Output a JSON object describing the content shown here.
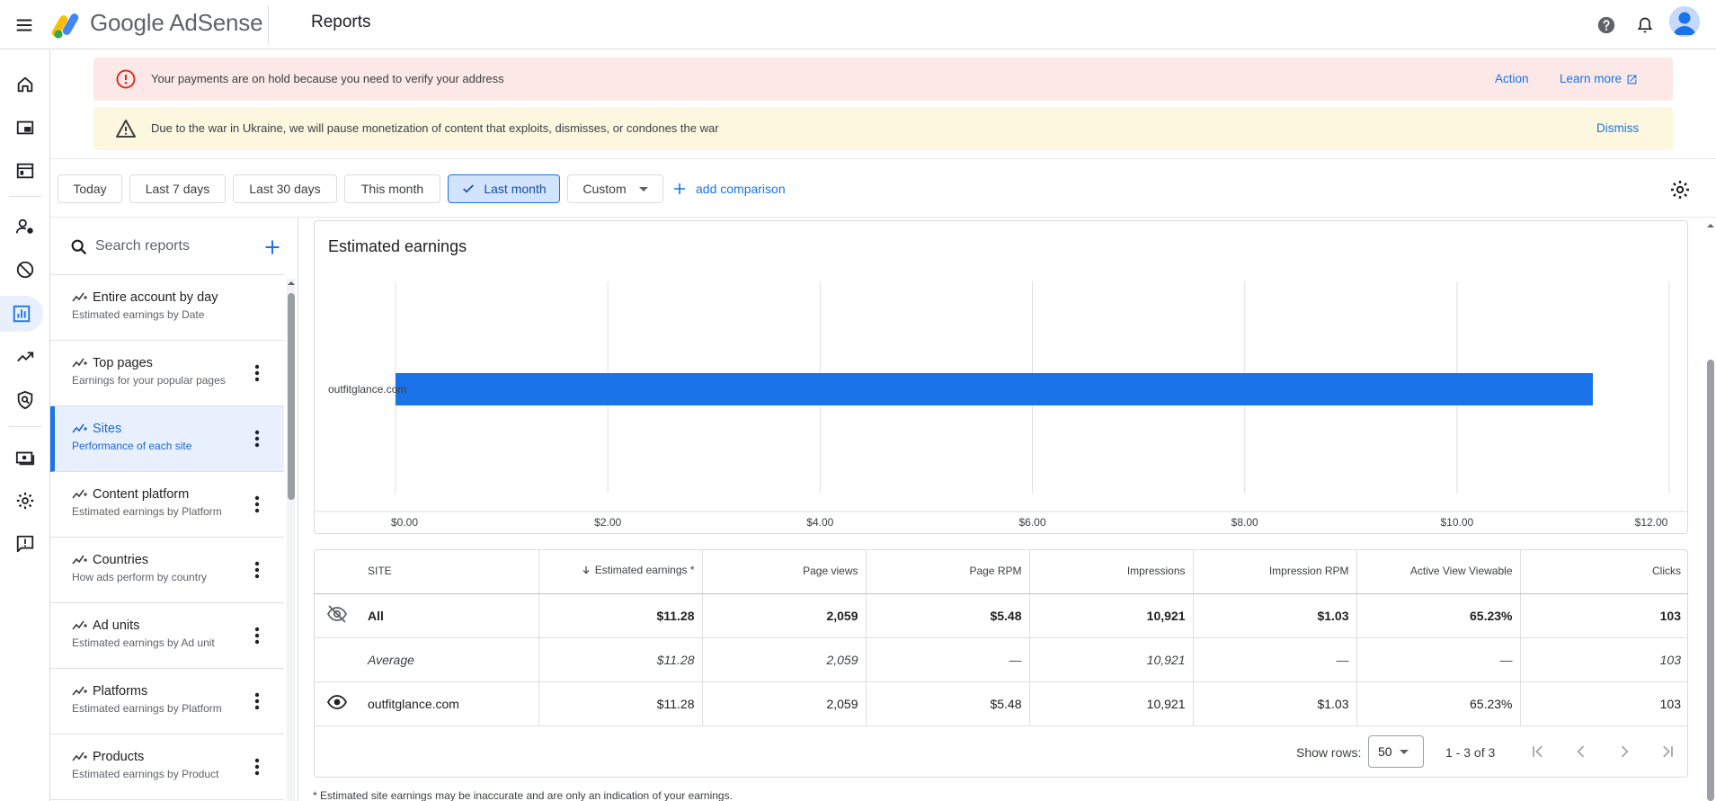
{
  "app": {
    "brand_google": "Google",
    "brand_product": "AdSense",
    "page_title": "Reports",
    "accent": "#1a73e8"
  },
  "topbar": {
    "icons": [
      "menu-icon",
      "help-icon",
      "bell-icon",
      "account-avatar"
    ]
  },
  "rail": {
    "icons": [
      "home-icon",
      "ads-icon",
      "sites-icon",
      "privacy-messaging-icon",
      "blocking-controls-icon",
      "reports-icon",
      "optimization-icon",
      "brand-safety-icon",
      "payments-icon",
      "settings-icon",
      "feedback-icon"
    ],
    "active": "reports-icon"
  },
  "banners": {
    "payment_hold": {
      "text": "Your payments are on hold because you need to verify your address",
      "action": "Action",
      "learn_more": "Learn more",
      "color": "#fce8e6"
    },
    "ukraine": {
      "text": "Due to the war in Ukraine, we will pause monetization of content that exploits, dismisses, or condones the war",
      "dismiss": "Dismiss",
      "color": "#fef7e0"
    }
  },
  "date_range": {
    "chips": [
      "Today",
      "Last 7 days",
      "Last 30 days",
      "This month",
      "Last month",
      "Custom"
    ],
    "selected": "Last month",
    "add_comparison": "add comparison"
  },
  "reports_list": {
    "search_placeholder": "Search reports",
    "items": [
      {
        "title": "Entire account by day",
        "subtitle": "Estimated earnings by Date"
      },
      {
        "title": "Top pages",
        "subtitle": "Earnings for your popular pages"
      },
      {
        "title": "Sites",
        "subtitle": "Performance of each site"
      },
      {
        "title": "Content platform",
        "subtitle": "Estimated earnings by Platform"
      },
      {
        "title": "Countries",
        "subtitle": "How ads perform by country"
      },
      {
        "title": "Ad units",
        "subtitle": "Estimated earnings by Ad unit"
      },
      {
        "title": "Platforms",
        "subtitle": "Estimated earnings by Platform"
      },
      {
        "title": "Products",
        "subtitle": "Estimated earnings by Product"
      }
    ],
    "selected": "Sites"
  },
  "chart_data": {
    "type": "bar",
    "orientation": "horizontal",
    "title": "Estimated earnings",
    "categories": [
      "outfitglance.com"
    ],
    "values": [
      11.28
    ],
    "xlim": [
      0,
      12
    ],
    "x_ticks": [
      "$0.00",
      "$2.00",
      "$4.00",
      "$6.00",
      "$8.00",
      "$10.00",
      "$12.00"
    ],
    "tick_values": [
      0,
      2,
      4,
      6,
      8,
      10,
      12
    ],
    "bar_color": "#1a73e8",
    "grid": true
  },
  "table": {
    "headers": [
      "SITE",
      "Estimated earnings *",
      "Page views",
      "Page RPM",
      "Impressions",
      "Impression RPM",
      "Active View Viewable",
      "Clicks"
    ],
    "rows": [
      {
        "kind": "total",
        "icon": "eye-off-icon",
        "cells": [
          "All",
          "$11.28",
          "2,059",
          "$5.48",
          "10,921",
          "$1.03",
          "65.23%",
          "103"
        ]
      },
      {
        "kind": "avg",
        "icon": "",
        "cells": [
          "Average",
          "$11.28",
          "2,059",
          "—",
          "10,921",
          "—",
          "—",
          "103"
        ]
      },
      {
        "kind": "row",
        "icon": "eye-icon",
        "cells": [
          "outfitglance.com",
          "$11.28",
          "2,059",
          "$5.48",
          "10,921",
          "$1.03",
          "65.23%",
          "103"
        ]
      }
    ],
    "sort_column": "Estimated earnings *"
  },
  "pagination": {
    "show_rows_label": "Show rows:",
    "rows_per_page": "50",
    "range": "1 - 3 of 3"
  },
  "footnote": "* Estimated site earnings may be inaccurate and are only an indication of your earnings."
}
